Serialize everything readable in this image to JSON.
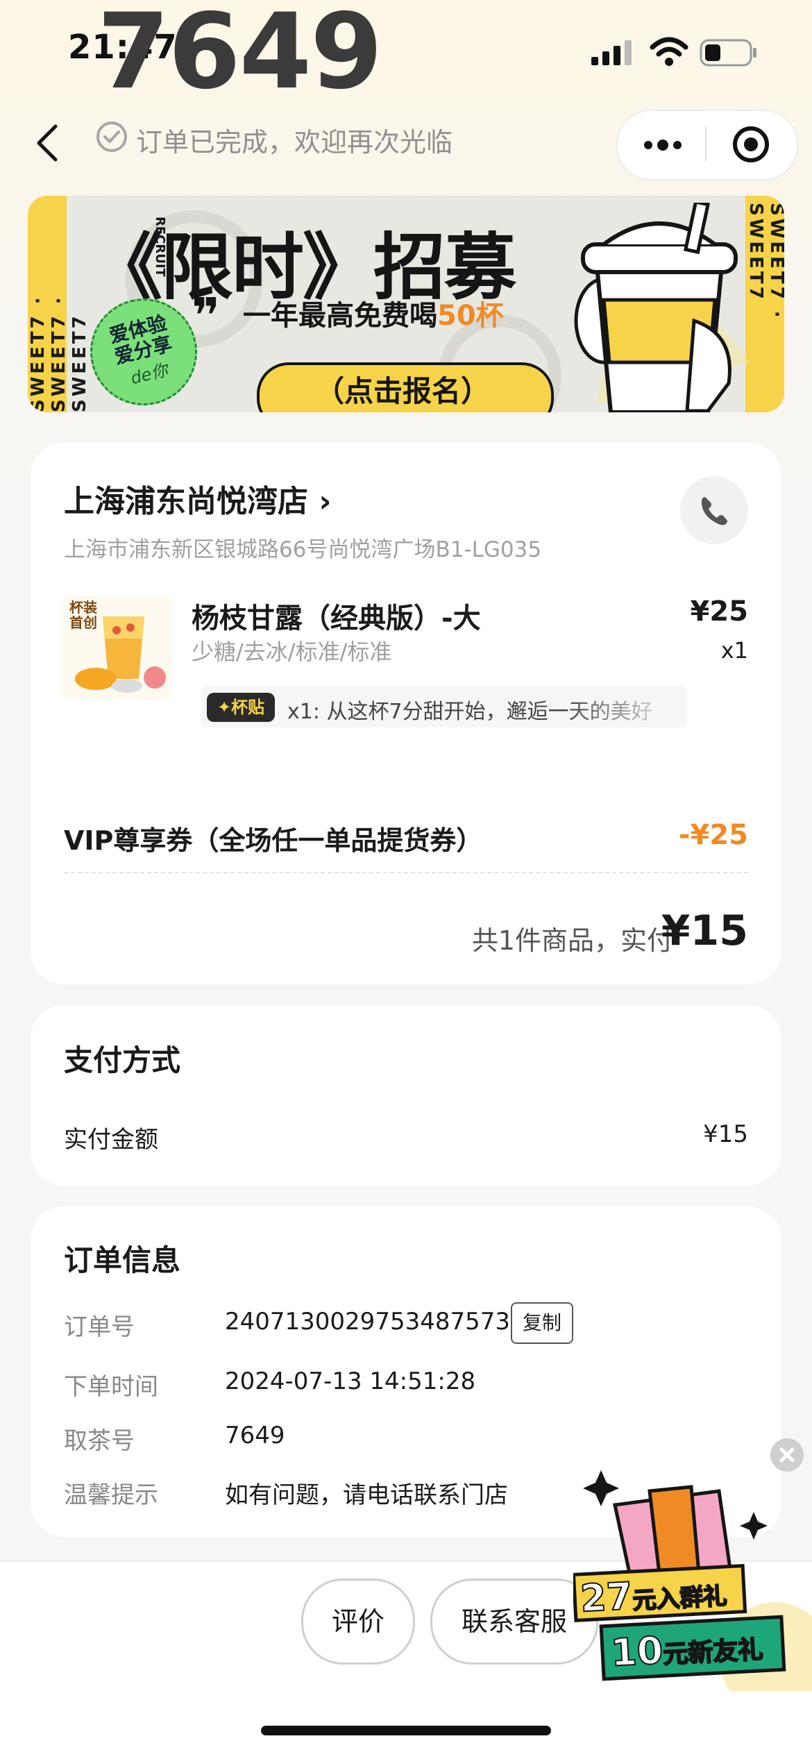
{
  "status_bar": {
    "time": "21:47",
    "pickup_overlay": "7649"
  },
  "nav": {
    "order_status": "订单已完成，欢迎再次光临"
  },
  "banner": {
    "strip_text": "SWEET7 · SWEET7 · SWEET7",
    "title": "《限时》招募",
    "logo_text": "RECRUIT",
    "subtitle_prefix": "一年最高免费喝",
    "subtitle_highlight": "50杯",
    "badge_line1": "爱体验",
    "badge_line2": "爱分享",
    "badge_line3": "de你",
    "button": "（点击报名）"
  },
  "store": {
    "name": "上海浦东尚悦湾店",
    "address": "上海市浦东新区银城路66号尚悦湾广场B1-LG035"
  },
  "product": {
    "image_caption_1": "杯装",
    "image_caption_2": "首创",
    "name": "杨枝甘露（经典版）-大",
    "spec": "少糖/去冰/标准/标准",
    "price": "¥25",
    "qty": "x1",
    "sticker_badge": "杯贴",
    "sticker_text": "x1: 从这杯7分甜开始，邂逅一天的美好"
  },
  "coupon": {
    "name": "VIP尊享券（全场任一单品提货券）",
    "value": "-¥25"
  },
  "total": {
    "label": "共1件商品，实付",
    "value": "¥15"
  },
  "payment": {
    "title": "支付方式",
    "row_label": "实付金额",
    "row_value": "¥15"
  },
  "order_info": {
    "title": "订单信息",
    "rows": [
      {
        "label": "订单号",
        "value": "2407130029753487573"
      },
      {
        "label": "下单时间",
        "value": "2024-07-13 14:51:28"
      },
      {
        "label": "取茶号",
        "value": "7649"
      },
      {
        "label": "温馨提示",
        "value": "如有问题，请电话联系门店"
      }
    ],
    "copy_button": "复制"
  },
  "bottom": {
    "review_button": "评价",
    "service_button": "联系客服"
  },
  "promo": {
    "line1_num": "27",
    "line1_text": "元入群礼",
    "line2_num": "10",
    "line2_text": "元新友礼"
  },
  "colors": {
    "accent_orange": "#f08a24",
    "banner_yellow": "#f7d34a"
  }
}
